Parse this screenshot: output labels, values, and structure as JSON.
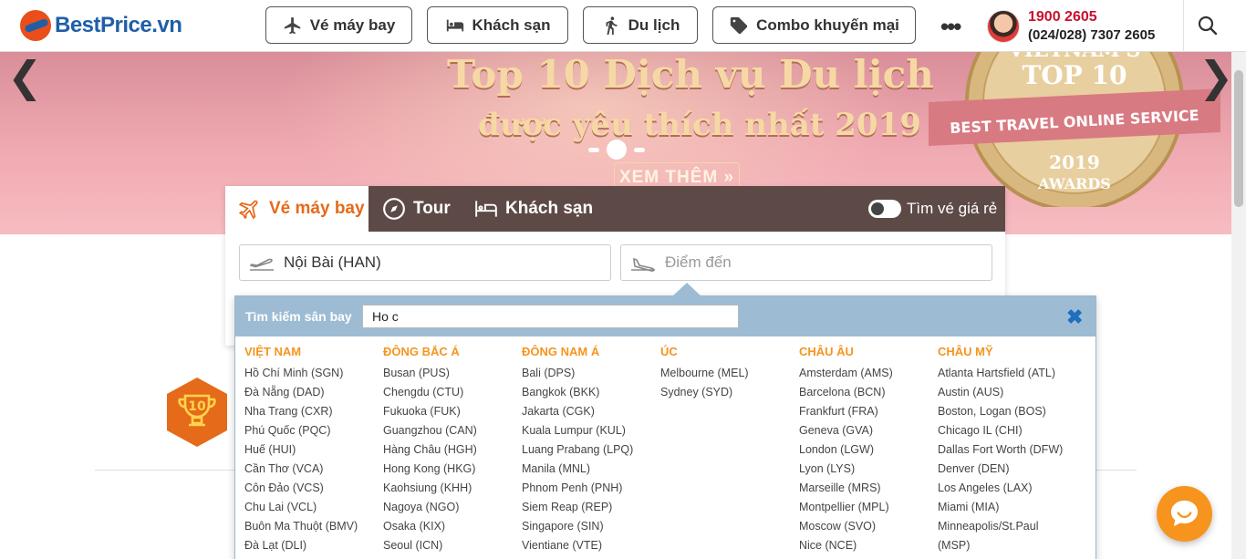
{
  "header": {
    "logo_text": "BestPrice.vn",
    "nav": [
      {
        "label": "Vé máy bay",
        "icon": "plane-icon"
      },
      {
        "label": "Khách sạn",
        "icon": "bed-icon"
      },
      {
        "label": "Du lịch",
        "icon": "hiker-icon"
      },
      {
        "label": "Combo khuyến mại",
        "icon": "tag-icon"
      }
    ],
    "more": "•••",
    "hotline": "1900 2605",
    "hotline_alt": "(024/028) 7307 2605"
  },
  "banner": {
    "title": "Top 10 Dịch vụ Du lịch",
    "subtitle": "được yêu thích nhất 2019",
    "cta": "XEM THÊM »",
    "badge_lines": [
      "VIETNAM'S",
      "TOP 10",
      "BEST TRAVEL ONLINE SERVICE",
      "2019",
      "AWARDS"
    ],
    "prev": "❮",
    "next": "❯"
  },
  "search": {
    "tabs": [
      {
        "label": "Vé máy bay",
        "active": true
      },
      {
        "label": "Tour",
        "active": false
      },
      {
        "label": "Khách sạn",
        "active": false
      }
    ],
    "toggle_label": "Tìm vé giá rẻ",
    "origin_value": "Nội Bài (HAN)",
    "destination_placeholder": "Điểm đến"
  },
  "airport_picker": {
    "label": "Tìm kiếm sân bay",
    "query": "Ho c",
    "close": "✖",
    "columns": [
      {
        "title": "VIỆT NAM",
        "items": [
          "Hồ Chí Minh (SGN)",
          "Đà Nẵng (DAD)",
          "Nha Trang (CXR)",
          "Phú Quốc (PQC)",
          "Huế (HUI)",
          "Cần Thơ (VCA)",
          "Côn Đảo (VCS)",
          "Chu Lai (VCL)",
          "Buôn Ma Thuột (BMV)",
          "Đà Lạt (DLI)"
        ]
      },
      {
        "title": "ĐÔNG BẮC Á",
        "items": [
          "Busan (PUS)",
          "Chengdu (CTU)",
          "Fukuoka (FUK)",
          "Guangzhou (CAN)",
          "Hàng Châu (HGH)",
          "Hong Kong (HKG)",
          "Kaohsiung (KHH)",
          "Nagoya (NGO)",
          "Osaka (KIX)",
          "Seoul (ICN)"
        ]
      },
      {
        "title": "ĐÔNG NAM Á",
        "items": [
          "Bali (DPS)",
          "Bangkok (BKK)",
          "Jakarta (CGK)",
          "Kuala Lumpur (KUL)",
          "Luang Prabang (LPQ)",
          "Manila (MNL)",
          "Phnom Penh (PNH)",
          "Siem Reap (REP)",
          "Singapore (SIN)",
          "Vientiane (VTE)"
        ]
      },
      {
        "title": "ÚC",
        "items": [
          "Melbourne (MEL)",
          "Sydney (SYD)"
        ]
      },
      {
        "title": "CHÂU ÂU",
        "items": [
          "Amsterdam (AMS)",
          "Barcelona (BCN)",
          "Frankfurt (FRA)",
          "Geneva (GVA)",
          "London (LGW)",
          "Lyon (LYS)",
          "Marseille (MRS)",
          "Montpellier (MPL)",
          "Moscow (SVO)",
          "Nice (NCE)"
        ]
      },
      {
        "title": "CHÂU MỸ",
        "items": [
          "Atlanta Hartsfield (ATL)",
          "Austin (AUS)",
          "Boston, Logan (BOS)",
          "Chicago IL (CHI)",
          "Dallas Fort Worth (DFW)",
          "Denver (DEN)",
          "Los Angeles (LAX)",
          "Miami (MIA)",
          "Minneapolis/St.Paul",
          "(MSP)"
        ]
      }
    ]
  },
  "colors": {
    "brand_blue": "#1f5fa8",
    "brand_orange": "#e56a1a",
    "hotline_red": "#c8102e",
    "tab_bar": "#5d4a47",
    "picker_header": "#9dbcd3",
    "region_title": "#f7941d"
  }
}
